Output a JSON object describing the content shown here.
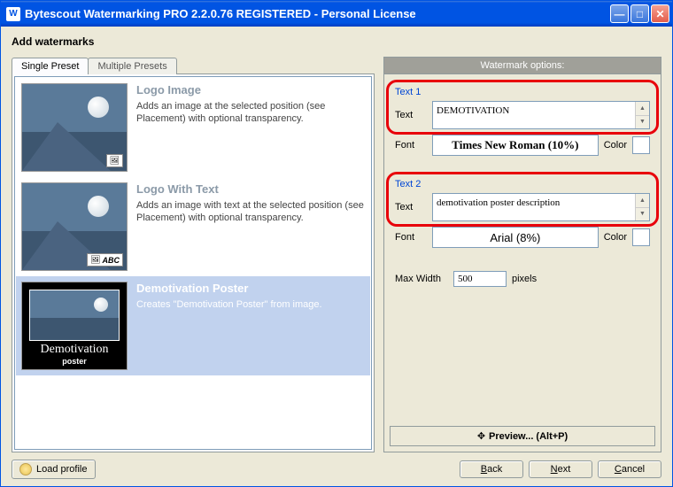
{
  "window": {
    "title": "Bytescout Watermarking PRO 2.2.0.76 REGISTERED - Personal License"
  },
  "heading": "Add watermarks",
  "tabs": {
    "single": "Single Preset",
    "multiple": "Multiple Presets"
  },
  "presets": [
    {
      "title": "Logo Image",
      "desc": "Adds an image at the selected position (see Placement) with optional transparency.",
      "badge": ""
    },
    {
      "title": "Logo With Text",
      "desc": "Adds an image with text at the selected position (see Placement) with optional transparency.",
      "badge": "ABC"
    },
    {
      "title": "Demotivation Poster",
      "desc": "Creates \"Demotivation Poster\" from image.",
      "cap1": "Demotivation",
      "cap2": "poster"
    }
  ],
  "options": {
    "header": "Watermark options:",
    "text1": {
      "group_label": "Text 1",
      "text_label": "Text",
      "value": "DEMOTIVATION",
      "font_label": "Font",
      "font_display": "Times New Roman (10%)",
      "color_label": "Color"
    },
    "text2": {
      "group_label": "Text 2",
      "text_label": "Text",
      "value": "demotivation poster description",
      "font_label": "Font",
      "font_display": "Arial (8%)",
      "color_label": "Color"
    },
    "maxwidth": {
      "label": "Max Width",
      "value": "500",
      "unit": "pixels"
    },
    "preview": "Preview... (Alt+P)"
  },
  "buttons": {
    "load": "Load profile",
    "back": "Back",
    "next": "Next",
    "cancel": "Cancel"
  }
}
